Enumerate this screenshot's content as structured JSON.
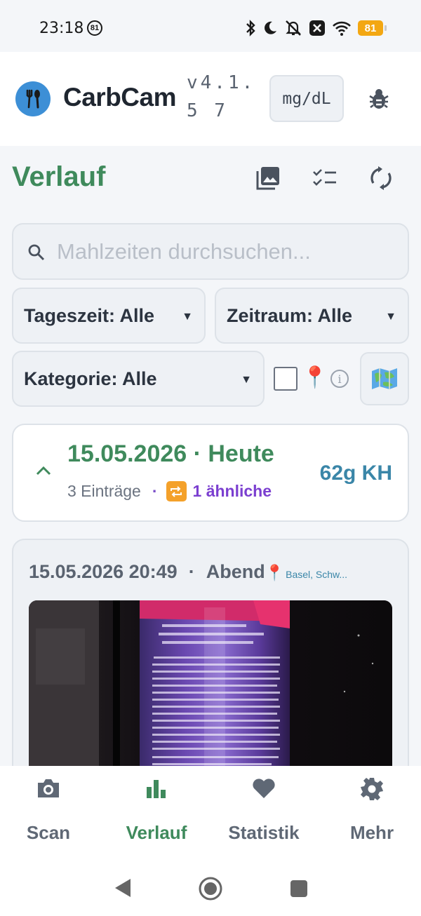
{
  "status_bar": {
    "time": "23:18",
    "notification_badge": "81",
    "battery": "81"
  },
  "app": {
    "title": "CarbCam",
    "version": "v4.1.5 7",
    "unit": "mg/dL",
    "brand_color": "#3f8a5c"
  },
  "page": {
    "title": "Verlauf"
  },
  "search": {
    "placeholder": "Mahlzeiten durchsuchen...",
    "value": ""
  },
  "filters": {
    "daytime": "Tageszeit: Alle",
    "period": "Zeitraum: Alle",
    "category": "Kategorie: Alle",
    "location_checked": false
  },
  "day_group": {
    "title": "15.05.2026 · Heute",
    "entries": "3 Einträge",
    "separator": "·",
    "similar": "1 ähnliche",
    "total": "62g KH"
  },
  "meal": {
    "datetime": "15.05.2026 20:49",
    "separator": "·",
    "daytime": "Abend",
    "location": "Basel, Schw..."
  },
  "bottom_nav": [
    {
      "label": "Scan",
      "icon": "camera-icon",
      "active": false
    },
    {
      "label": "Verlauf",
      "icon": "bar-chart-icon",
      "active": true
    },
    {
      "label": "Statistik",
      "icon": "heart-icon",
      "active": false
    },
    {
      "label": "Mehr",
      "icon": "gear-icon",
      "active": false
    }
  ]
}
